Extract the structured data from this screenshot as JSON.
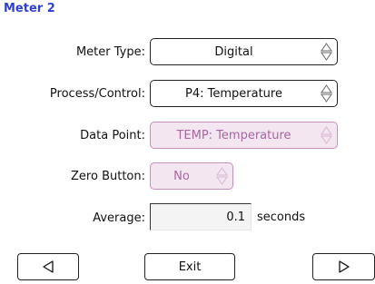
{
  "title": "Meter 2",
  "fields": {
    "meter_type": {
      "label": "Meter Type:",
      "value": "Digital"
    },
    "process_control": {
      "label": "Process/Control:",
      "value": "P4: Temperature"
    },
    "data_point": {
      "label": "Data Point:",
      "value": "TEMP: Temperature"
    },
    "zero_button": {
      "label": "Zero Button:",
      "value": "No"
    },
    "average": {
      "label": "Average:",
      "value": "0.1",
      "unit": "seconds"
    }
  },
  "buttons": {
    "exit_label": "Exit"
  },
  "icons": {
    "prev": "left-triangle-icon",
    "next": "right-triangle-icon",
    "spin": "up-down-arrows-icon"
  },
  "colors": {
    "title": "#2e3fd6",
    "disabled_bg": "#f4e6f1",
    "disabled_border": "#c490b7",
    "disabled_text": "#a866a0"
  }
}
